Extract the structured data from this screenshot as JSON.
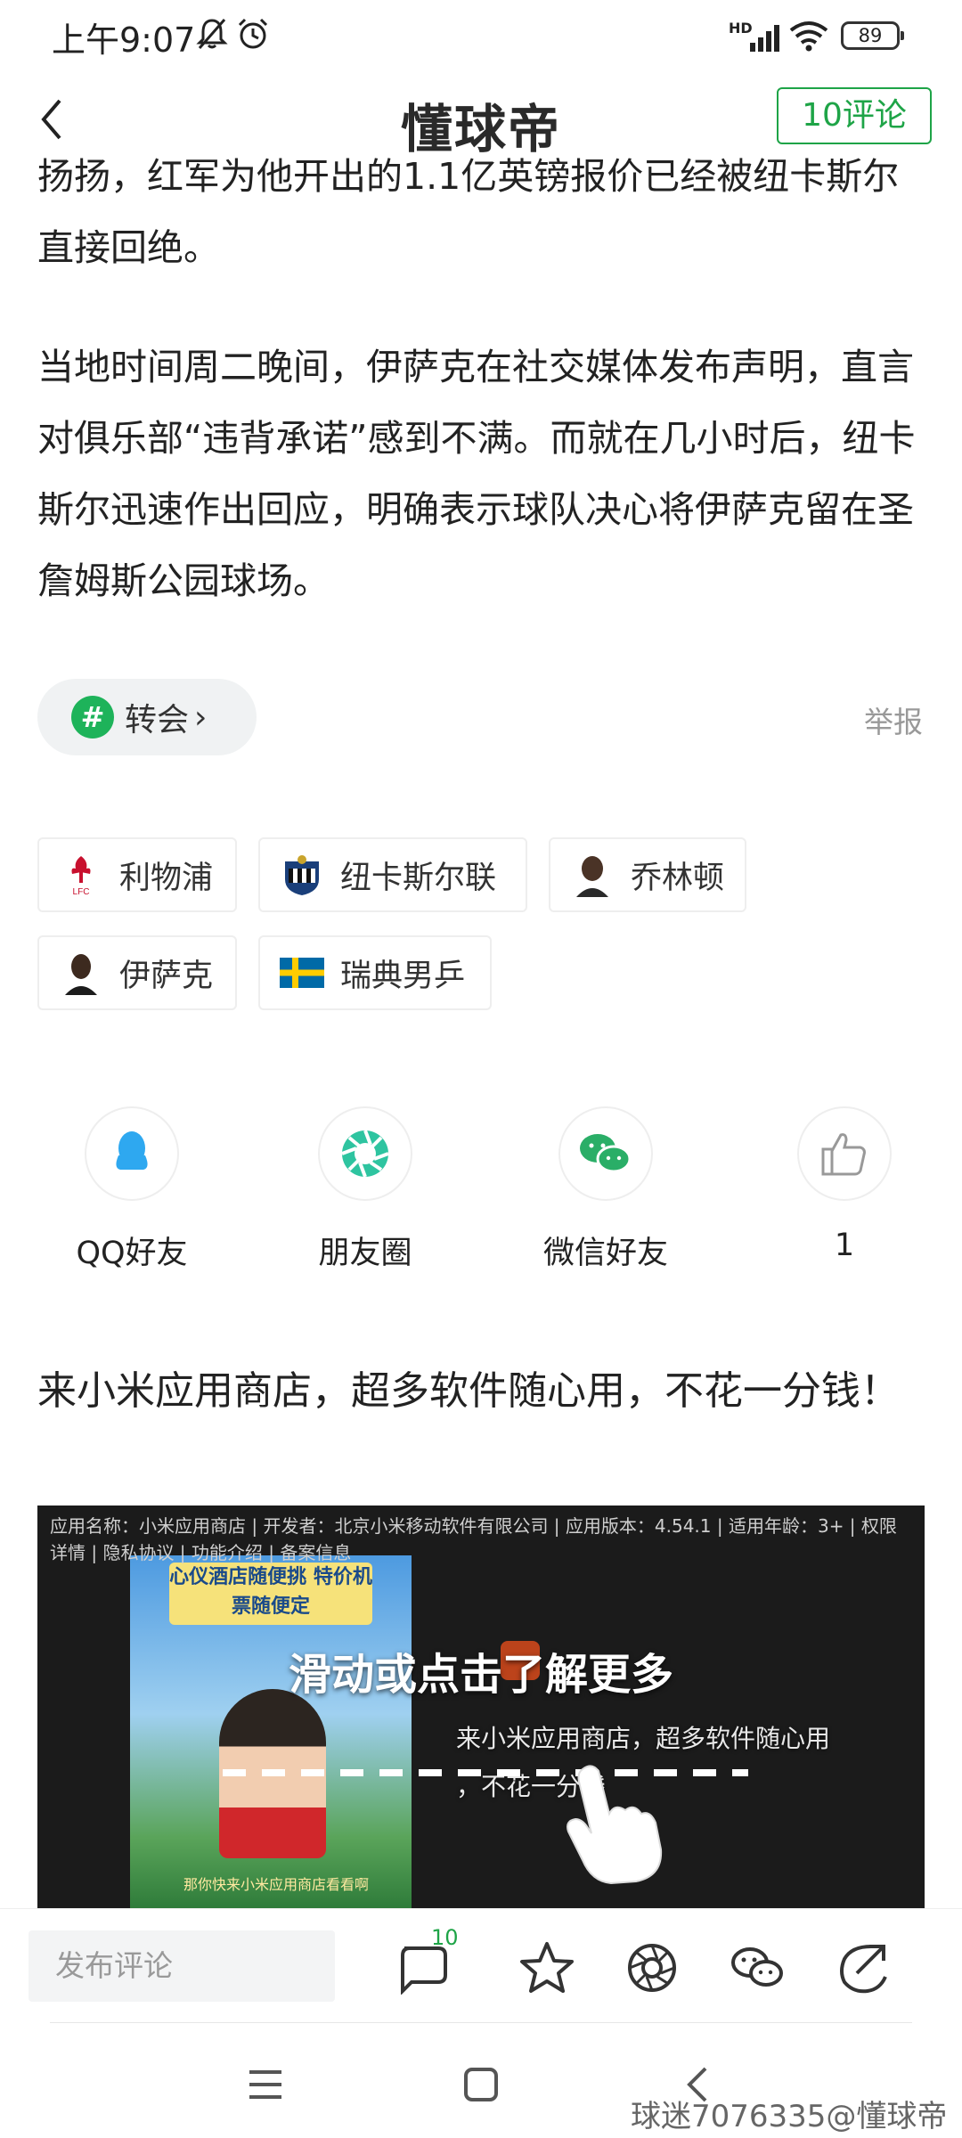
{
  "status_bar": {
    "time": "上午9:07",
    "battery": "89",
    "network": "HD"
  },
  "header": {
    "logo": "懂球帝",
    "comment_button": "10评论"
  },
  "article": {
    "paragraphs": [
      "扬扬，红军为他开出的1.1亿英镑报价已经被纽卡斯尔直接回绝。",
      "当地时间周二晚间，伊萨克在社交媒体发布声明，直言对俱乐部“违背承诺”感到不满。而就在几小时后，纽卡斯尔迅速作出回应，明确表示球队决心将伊萨克留在圣詹姆斯公园球场。"
    ]
  },
  "topic": {
    "hash": "#",
    "label": "转会",
    "chevron": "›",
    "report": "举报"
  },
  "tags": [
    {
      "label": "利物浦",
      "icon": "liverpool-crest-icon",
      "badge": "LFC"
    },
    {
      "label": "纽卡斯尔联",
      "icon": "newcastle-crest-icon"
    },
    {
      "label": "乔林顿",
      "icon": "player-avatar-icon"
    },
    {
      "label": "伊萨克",
      "icon": "player-avatar-icon"
    },
    {
      "label": "瑞典男乒",
      "icon": "sweden-flag-icon"
    }
  ],
  "share": [
    {
      "label": "QQ好友",
      "icon": "qq-icon"
    },
    {
      "label": "朋友圈",
      "icon": "moments-icon"
    },
    {
      "label": "微信好友",
      "icon": "wechat-icon"
    },
    {
      "label": "1",
      "icon": "thumbs-up-icon"
    }
  ],
  "ad": {
    "title": "来小米应用商店，超多软件随心用，不花一分钱！",
    "meta": "应用名称：小米应用商店 | 开发者：北京小米移动软件有限公司 | 应用版本：4.54.1 | 适用年龄：3+ | 权限详情 | 隐私协议 | 功能介绍 | 备案信息",
    "poster_banner": "心仪酒店随便挑 特价机票随便定",
    "poster_caption": "那你快来小米应用商店看看啊",
    "cta": "滑动或点击了解更多",
    "subtitle": "来小米应用商店，超多软件随心用",
    "subtitle2": "，不花一分钱"
  },
  "bottom_bar": {
    "comment_placeholder": "发布评论",
    "comment_badge": "10"
  },
  "system_nav": {
    "watermark": "球迷7076335@懂球帝"
  },
  "colors": {
    "accent_green": "#1ea447",
    "topic_green": "#1eb35a",
    "qq_blue": "#2ea8f0",
    "wechat_green": "#2aae67"
  }
}
